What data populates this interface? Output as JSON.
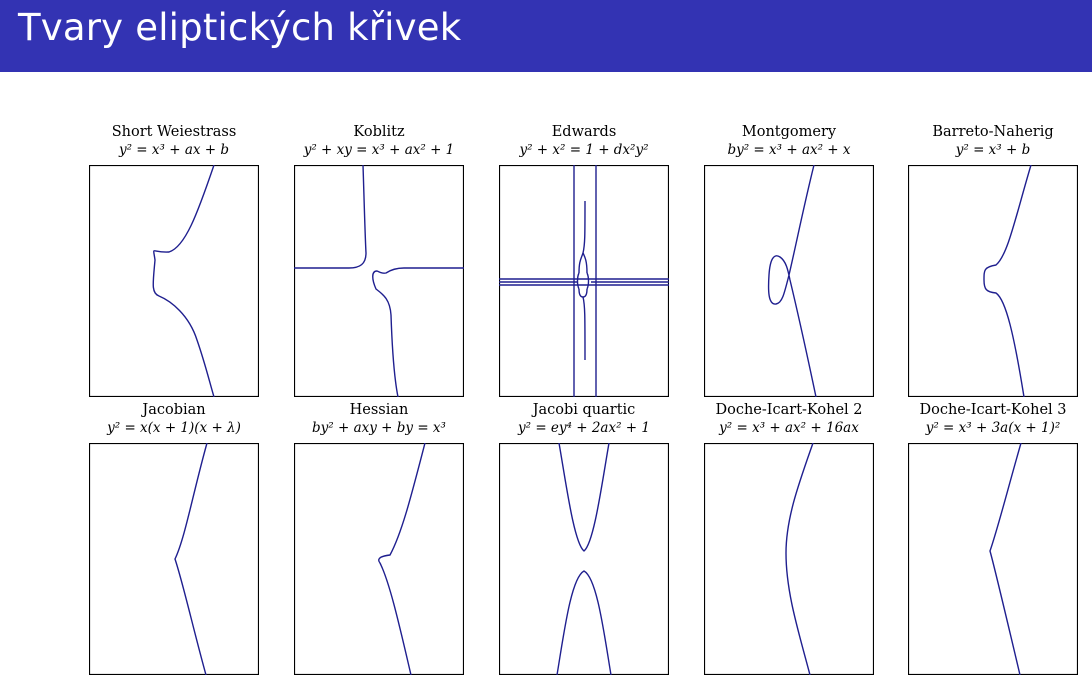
{
  "slide": {
    "title": "Tvary eliptických křivek"
  },
  "colors": {
    "title_bar": "#3333b3",
    "curve": "#1f1f8f",
    "frame": "#000000"
  },
  "panels": [
    {
      "id": "short-weierstrass",
      "name": "Short Weiestrass",
      "equation": "y² = x³ + ax + b"
    },
    {
      "id": "koblitz",
      "name": "Koblitz",
      "equation": "y² + xy = x³ + ax² + 1"
    },
    {
      "id": "edwards",
      "name": "Edwards",
      "equation": "y² + x² = 1 + dx²y²"
    },
    {
      "id": "montgomery",
      "name": "Montgomery",
      "equation": "by² = x³ + ax² + x"
    },
    {
      "id": "barreto-naherig",
      "name": "Barreto-Naherig",
      "equation": "y² = x³ + b"
    },
    {
      "id": "jacobian",
      "name": "Jacobian",
      "equation": "y² = x(x + 1)(x + λ)"
    },
    {
      "id": "hessian",
      "name": "Hessian",
      "equation": "by² + axy + by = x³"
    },
    {
      "id": "jacobi-quartic",
      "name": "Jacobi quartic",
      "equation": "y² = ey⁴ + 2ax² + 1"
    },
    {
      "id": "doche-icart-kohel-2",
      "name": "Doche-Icart-Kohel 2",
      "equation": "y² = x³ + ax² + 16ax"
    },
    {
      "id": "doche-icart-kohel-3",
      "name": "Doche-Icart-Kohel 3",
      "equation": "y² = x³ + 3a(x + 1)²"
    }
  ]
}
